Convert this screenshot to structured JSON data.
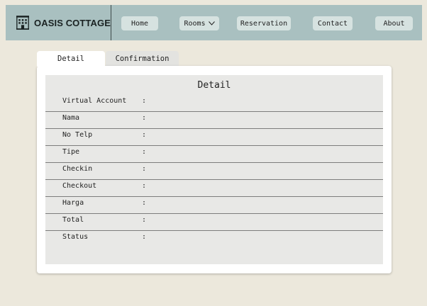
{
  "brand": {
    "name": "OASIS COTTAGE",
    "logo_icon": "hotel-building-icon"
  },
  "nav": {
    "items": [
      {
        "label": "Home"
      },
      {
        "label": "Rooms",
        "icon": "chevron-down-icon"
      },
      {
        "label": "Reservation"
      },
      {
        "label": "Contact"
      },
      {
        "label": "About"
      }
    ]
  },
  "tabs": [
    {
      "label": "Detail",
      "active": true
    },
    {
      "label": "Confirmation",
      "active": false
    }
  ],
  "detail": {
    "title": "Detail",
    "fields": [
      {
        "label": "Virtual Account",
        "colon": ":",
        "value": ""
      },
      {
        "label": "Nama",
        "colon": ":",
        "value": ""
      },
      {
        "label": "No Telp",
        "colon": ":",
        "value": ""
      },
      {
        "label": "Tipe",
        "colon": ":",
        "value": ""
      },
      {
        "label": "Checkin",
        "colon": ":",
        "value": ""
      },
      {
        "label": "Checkout",
        "colon": ":",
        "value": ""
      },
      {
        "label": "Harga",
        "colon": ":",
        "value": ""
      },
      {
        "label": "Total",
        "colon": ":",
        "value": ""
      },
      {
        "label": "Status",
        "colon": ":",
        "value": ""
      }
    ]
  },
  "colors": {
    "navbar": "#a9c0c0",
    "nav_button": "#d6e2e0",
    "page_background": "#ece8dc",
    "panel": "#e8e8e6"
  }
}
